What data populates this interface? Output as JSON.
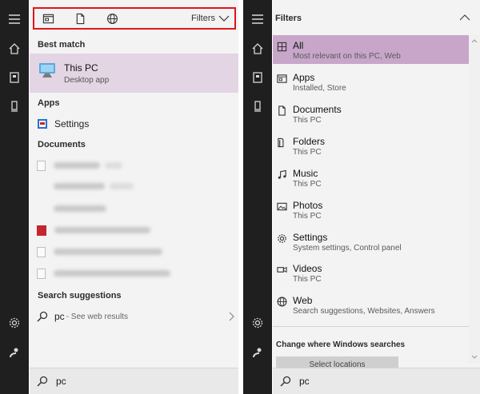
{
  "query": "pc",
  "left": {
    "filters_label": "Filters",
    "best_match_heading": "Best match",
    "best_match": {
      "title": "This PC",
      "subtitle": "Desktop app"
    },
    "apps_heading": "Apps",
    "apps": [
      {
        "label": "Settings"
      }
    ],
    "documents_heading": "Documents",
    "documents": [
      {
        "kind": "doc"
      },
      {
        "kind": "blank"
      },
      {
        "kind": "blank"
      },
      {
        "kind": "pdf"
      },
      {
        "kind": "doc"
      },
      {
        "kind": "doc"
      }
    ],
    "suggestions_heading": "Search suggestions",
    "suggestion": {
      "query": "pc",
      "hint": "- See web results"
    }
  },
  "right": {
    "filters_title": "Filters",
    "items": [
      {
        "label": "All",
        "sub": "Most relevant on this PC, Web",
        "icon": "grid-icon",
        "selected": true
      },
      {
        "label": "Apps",
        "sub": "Installed, Store",
        "icon": "app-window-icon"
      },
      {
        "label": "Documents",
        "sub": "This PC",
        "icon": "document-icon"
      },
      {
        "label": "Folders",
        "sub": "This PC",
        "icon": "folder-icon"
      },
      {
        "label": "Music",
        "sub": "This PC",
        "icon": "music-icon"
      },
      {
        "label": "Photos",
        "sub": "This PC",
        "icon": "photo-icon"
      },
      {
        "label": "Settings",
        "sub": "System settings, Control panel",
        "icon": "gear-icon"
      },
      {
        "label": "Videos",
        "sub": "This PC",
        "icon": "video-icon"
      },
      {
        "label": "Web",
        "sub": "Search suggestions, Websites, Answers",
        "icon": "globe-icon"
      }
    ],
    "change_heading": "Change where Windows searches",
    "select_locations": "Select locations"
  },
  "colors": {
    "accent_selection": "#e3d5e4",
    "filter_selected": "#c8a6ca",
    "highlight_border": "#e1151a",
    "rail": "#1f1f1f"
  }
}
